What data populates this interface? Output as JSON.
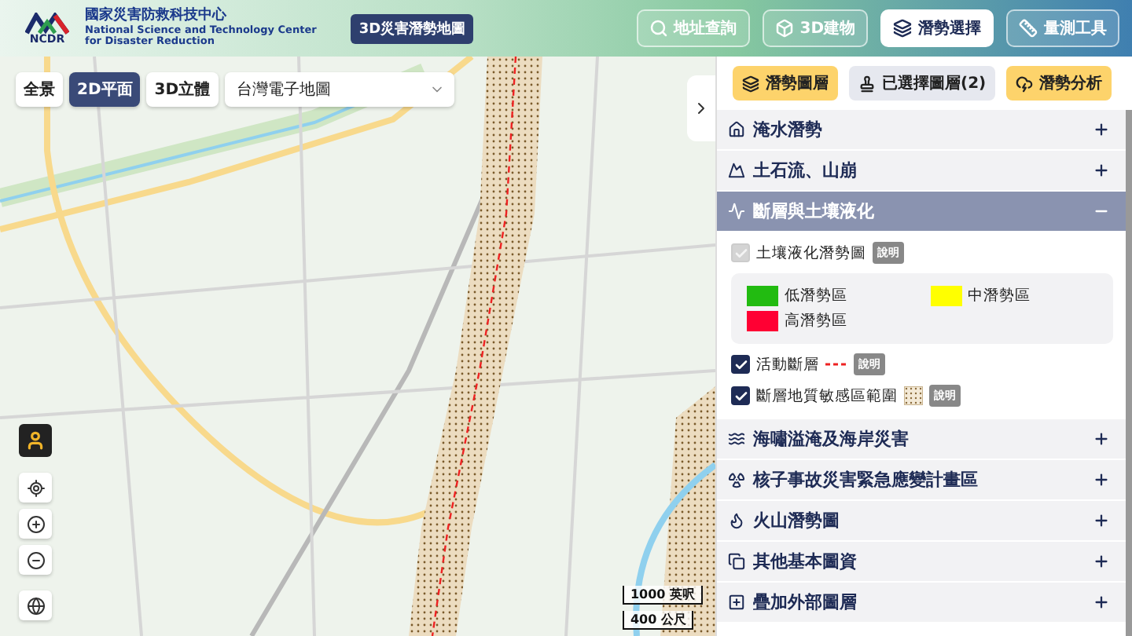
{
  "header": {
    "logo_text": "NCDR",
    "org_name": "國家災害防救科技中心",
    "org_name_en_1": "National Science and Technology Center",
    "org_name_en_2": "for Disaster Reduction",
    "app_title": "3D災害潛勢地圖",
    "nav": [
      {
        "label": "地址查詢",
        "selected": false
      },
      {
        "label": "3D建物",
        "selected": false
      },
      {
        "label": "潛勢選擇",
        "selected": true
      },
      {
        "label": "量測工具",
        "selected": false
      }
    ]
  },
  "map_toolbar": {
    "view_modes": [
      {
        "label": "全景",
        "selected": false
      },
      {
        "label": "2D平面",
        "selected": true
      },
      {
        "label": "3D立體",
        "selected": false
      }
    ],
    "basemap": "台灣電子地圖"
  },
  "scale": [
    "1000 英呎",
    "400 公尺"
  ],
  "panel": {
    "tabs": [
      {
        "label": "潛勢圖層",
        "kind": "primary"
      },
      {
        "label": "已選擇圖層(2)",
        "kind": "secondary"
      },
      {
        "label": "潛勢分析",
        "kind": "primary"
      }
    ],
    "categories": [
      {
        "label": "淹水潛勢",
        "expanded": false
      },
      {
        "label": "土石流、山崩",
        "expanded": false
      },
      {
        "label": "斷層與土壤液化",
        "expanded": true,
        "layers": [
          {
            "label": "土壤液化潛勢圖",
            "checked": true,
            "disabled": true,
            "kind": "none",
            "help": "說明",
            "classes": [
              {
                "label": "低潛勢區",
                "color": "#22bb11"
              },
              {
                "label": "中潛勢區",
                "color": "#ffff00"
              },
              {
                "label": "高潛勢區",
                "color": "#ff0033"
              }
            ]
          },
          {
            "label": "活動斷層",
            "checked": true,
            "disabled": false,
            "kind": "line",
            "help": "說明"
          },
          {
            "label": "斷層地質敏感區範圍",
            "checked": true,
            "disabled": false,
            "kind": "pattern",
            "help": "說明"
          }
        ]
      },
      {
        "label": "海嘯溢淹及海岸災害",
        "expanded": false
      },
      {
        "label": "核子事故災害緊急應變計畫區",
        "expanded": false
      },
      {
        "label": "火山潛勢圖",
        "expanded": false
      },
      {
        "label": "其他基本圖資",
        "expanded": false
      },
      {
        "label": "疊加外部圖層",
        "expanded": false
      }
    ]
  }
}
